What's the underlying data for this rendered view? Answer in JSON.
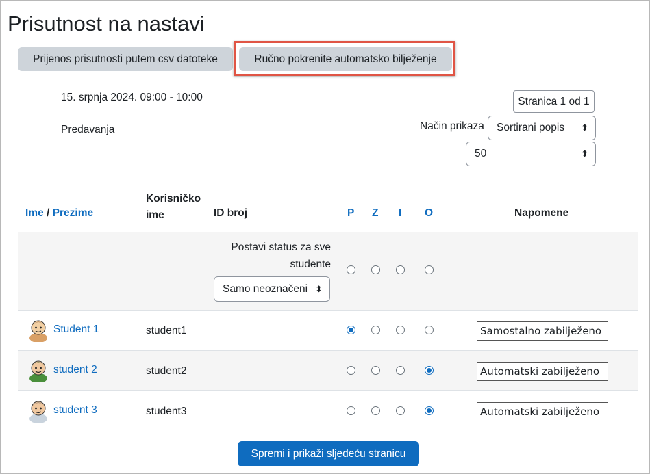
{
  "page": {
    "title": "Prisutnost na nastavi",
    "tabs": [
      {
        "label": "Prijenos prisutnosti putem csv datoteke"
      },
      {
        "label": "Ručno pokrenite automatsko bilježenje"
      }
    ]
  },
  "session": {
    "date": "15. srpnja 2024. 09:00 - 10:00",
    "type": "Predavanja"
  },
  "controls": {
    "pager": "Stranica 1 od 1",
    "view_label": "Način prikaza",
    "view_value": "Sortirani popis",
    "per_page_value": "50"
  },
  "table": {
    "headers": {
      "first_name": "Ime",
      "separator": "/",
      "last_name": "Prezime",
      "username": "Korisničko ime",
      "id_number": "ID broj",
      "statuses": [
        "P",
        "Z",
        "I",
        "O"
      ],
      "remarks": "Napomene"
    },
    "set_all": {
      "label": "Postavi status za sve studente",
      "select_value": "Samo neoznačeni",
      "selected_status": null
    },
    "rows": [
      {
        "name": "Student 1",
        "username": "student1",
        "id_number": "",
        "status": "P",
        "remark": "Samostalno zabilježeno",
        "avatar_icon": "student-avatar-icon"
      },
      {
        "name": "student 2",
        "username": "student2",
        "id_number": "",
        "status": "O",
        "remark": "Automatski zabilježeno",
        "avatar_icon": "student-avatar-icon"
      },
      {
        "name": "student 3",
        "username": "student3",
        "id_number": "",
        "status": "O",
        "remark": "Automatski zabilježeno",
        "avatar_icon": "student-avatar-icon"
      }
    ]
  },
  "submit_label": "Spremi i prikaži sljedeću stranicu",
  "colors": {
    "accent": "#0f6cbf",
    "highlight": "#e05545",
    "tab_bg": "#ced4da"
  }
}
